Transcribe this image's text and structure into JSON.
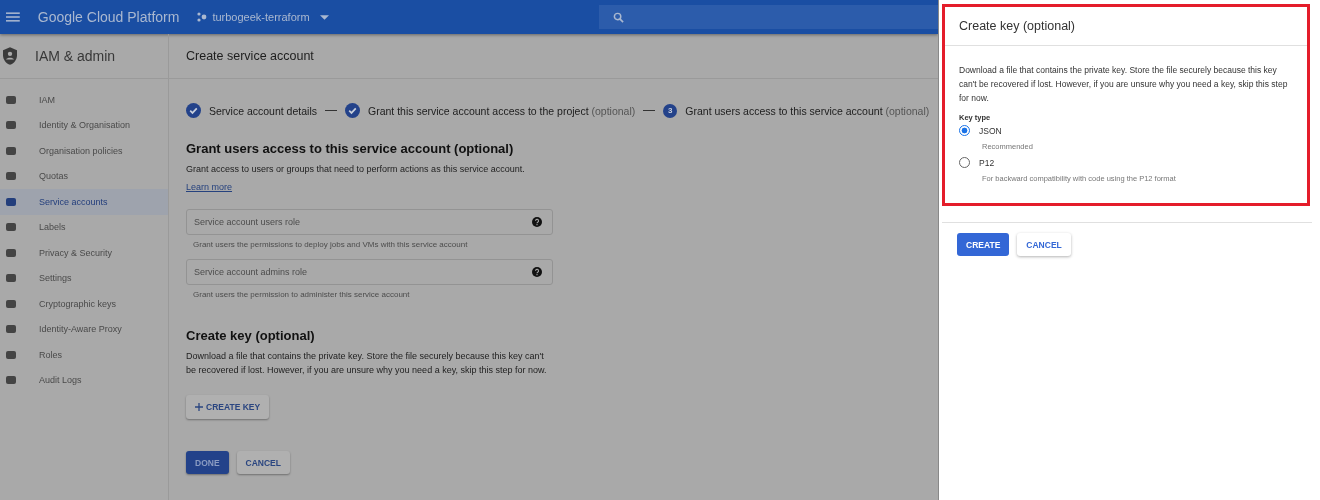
{
  "topbar": {
    "title": "Google Cloud Platform",
    "project": "turbogeek-terraform"
  },
  "sidebar": {
    "title": "IAM & admin",
    "items": [
      {
        "label": "IAM",
        "selected": false
      },
      {
        "label": "Identity & Organisation",
        "selected": false
      },
      {
        "label": "Organisation policies",
        "selected": false
      },
      {
        "label": "Quotas",
        "selected": false
      },
      {
        "label": "Service accounts",
        "selected": true
      },
      {
        "label": "Labels",
        "selected": false
      },
      {
        "label": "Privacy & Security",
        "selected": false
      },
      {
        "label": "Settings",
        "selected": false
      },
      {
        "label": "Cryptographic keys",
        "selected": false
      },
      {
        "label": "Identity-Aware Proxy",
        "selected": false
      },
      {
        "label": "Roles",
        "selected": false
      },
      {
        "label": "Audit Logs",
        "selected": false
      }
    ]
  },
  "page": {
    "title": "Create service account",
    "steps": [
      {
        "label": "Service account details",
        "done": true
      },
      {
        "label": "Grant this service account access to the project",
        "optional": "(optional)",
        "done": true
      },
      {
        "label": "Grant users access to this service account",
        "optional": "(optional)",
        "done": false,
        "number": "3"
      }
    ],
    "grant": {
      "heading": "Grant users access to this service account (optional)",
      "text": "Grant access to users or groups that need to perform actions as this service account.",
      "link": "Learn more",
      "fields": [
        {
          "placeholder": "Service account users role",
          "hint": "Grant users the permissions to deploy jobs and VMs with this service account"
        },
        {
          "placeholder": "Service account admins role",
          "hint": "Grant users the permission to administer this service account"
        }
      ]
    },
    "key": {
      "heading": "Create key (optional)",
      "text": "Download a file that contains the private key. Store the file securely because this key can't be recovered if lost. However, if you are unsure why you need a key, skip this step for now.",
      "button": "CREATE KEY"
    },
    "buttons": [
      "DONE",
      "CANCEL"
    ]
  },
  "panel": {
    "title": "Create key (optional)",
    "text": "Download a file that contains the private key. Store the file securely because this key can't be recovered if lost. However, if you are unsure why you need a key, skip this step for now.",
    "key_type_label": "Key type",
    "options": [
      {
        "label": "JSON",
        "hint": "Recommended",
        "selected": true
      },
      {
        "label": "P12",
        "hint": "For backward compatibility with code using the P12 format",
        "selected": false
      }
    ],
    "buttons": [
      "CREATE",
      "CANCEL"
    ]
  }
}
